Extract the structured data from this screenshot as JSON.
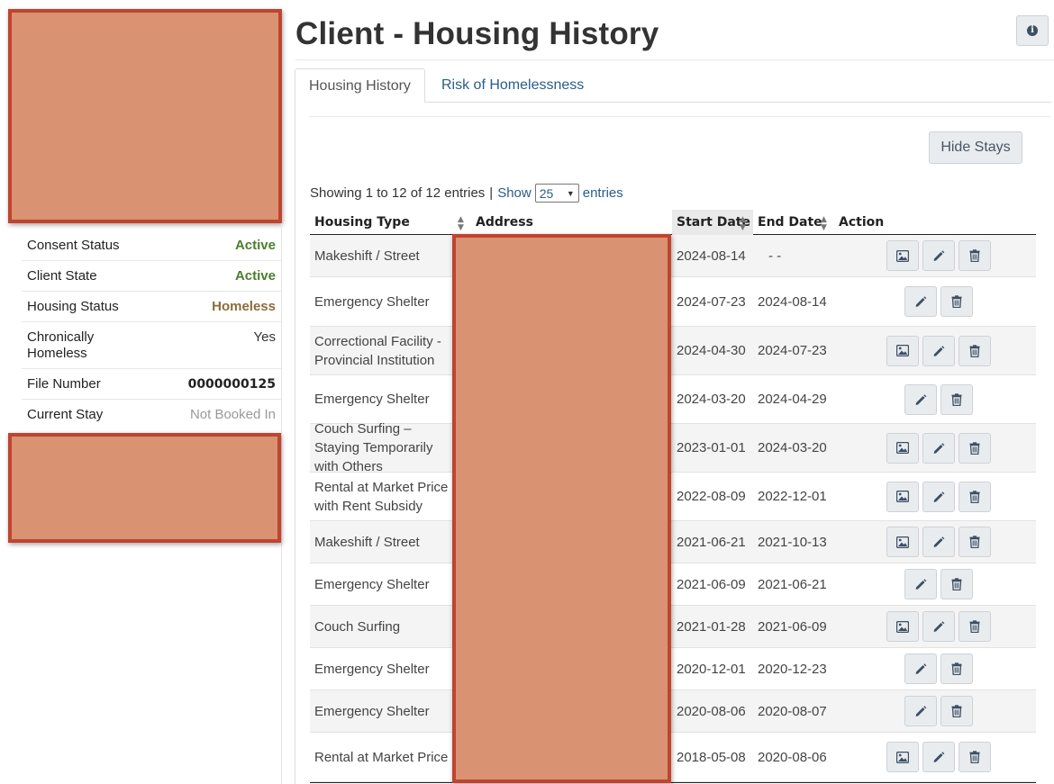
{
  "header": {
    "title": "Client - Housing History",
    "info_icon": "info-circle-icon"
  },
  "client_info": [
    {
      "label": "Consent Status",
      "value": "Active",
      "style": "active"
    },
    {
      "label": "Client State",
      "value": "Active",
      "style": "active"
    },
    {
      "label": "Housing Status",
      "value": "Homeless",
      "style": "homeless"
    },
    {
      "label": "Chronically Homeless",
      "value": "Yes",
      "style": "plain"
    },
    {
      "label": "File Number",
      "value": "0000000125",
      "style": "bold"
    },
    {
      "label": "Current Stay",
      "value": "Not Booked In",
      "style": "muted"
    }
  ],
  "tabs": [
    {
      "label": "Housing History",
      "active": true
    },
    {
      "label": "Risk of Homelessness",
      "active": false
    }
  ],
  "toolbar": {
    "hide_stays_label": "Hide Stays"
  },
  "entries": {
    "showing": "Showing 1 to 12 of 12 entries",
    "separator": "|",
    "show_label": "Show",
    "page_size": "25",
    "entries_label": "entries"
  },
  "table": {
    "columns": {
      "housing_type": "Housing Type",
      "address": "Address",
      "start_date": "Start Date",
      "end_date": "End Date",
      "action": "Action"
    },
    "rows": [
      {
        "housing_type": "Makeshift / Street",
        "start": "2024-08-14",
        "end": "- -",
        "image": true
      },
      {
        "housing_type": "Emergency Shelter",
        "start": "2024-07-23",
        "end": "2024-08-14",
        "image": false
      },
      {
        "housing_type": "Correctional Facility - Provincial Institution",
        "start": "2024-04-30",
        "end": "2024-07-23",
        "image": true
      },
      {
        "housing_type": "Emergency Shelter",
        "start": "2024-03-20",
        "end": "2024-04-29",
        "image": false
      },
      {
        "housing_type": "Couch Surfing – Staying Temporarily with Others",
        "start": "2023-01-01",
        "end": "2024-03-20",
        "image": true
      },
      {
        "housing_type": "Rental at Market Price with Rent Subsidy",
        "start": "2022-08-09",
        "end": "2022-12-01",
        "image": true
      },
      {
        "housing_type": "Makeshift / Street",
        "start": "2021-06-21",
        "end": "2021-10-13",
        "image": true
      },
      {
        "housing_type": "Emergency Shelter",
        "start": "2021-06-09",
        "end": "2021-06-21",
        "image": false
      },
      {
        "housing_type": "Couch Surfing",
        "start": "2021-01-28",
        "end": "2021-06-09",
        "image": true
      },
      {
        "housing_type": "Emergency Shelter",
        "start": "2020-12-01",
        "end": "2020-12-23",
        "image": false
      },
      {
        "housing_type": "Emergency Shelter",
        "start": "2020-08-06",
        "end": "2020-08-07",
        "image": false
      },
      {
        "housing_type": "Rental at Market Price",
        "start": "2018-05-08",
        "end": "2020-08-06",
        "image": true
      }
    ]
  },
  "icons": {
    "image": "image-icon",
    "edit": "pencil-icon",
    "delete": "trash-icon",
    "sort": "sort-icon"
  },
  "colors": {
    "active": "#4a7e2c",
    "homeless": "#8a6d3b",
    "link": "#2a5d8a",
    "redaction": "#d99373",
    "redaction_border": "#c0442e"
  }
}
